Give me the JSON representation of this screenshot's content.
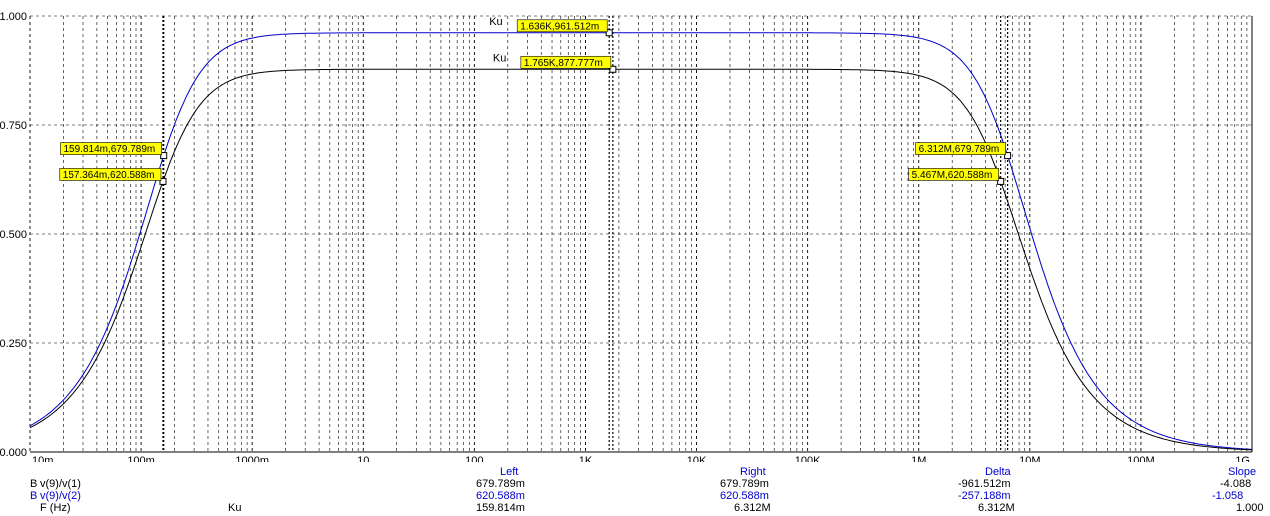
{
  "chart_data": {
    "type": "line",
    "x_scale": "log",
    "xlim": [
      0.01,
      1000000000
    ],
    "ylim": [
      0,
      1
    ],
    "grid": true,
    "y_ticks": [
      "0.000",
      "0.250",
      "0.500",
      "0.750",
      "1.000"
    ],
    "x_ticks": [
      "10m",
      "100m",
      "1000m",
      "10",
      "100",
      "1K",
      "10K",
      "100K",
      "1M",
      "10M",
      "100M",
      "1G"
    ],
    "series": [
      {
        "name": "Ku",
        "color": "#0000cc",
        "gain": 0.9615,
        "fl": 0.1598,
        "fh": 6312000
      },
      {
        "name": "Ku",
        "color": "#000000",
        "gain": 0.8778,
        "fl": 0.1574,
        "fh": 5467000
      }
    ],
    "curve_labels": [
      {
        "text": "Ku",
        "x": 1636,
        "y": 0.9615
      },
      {
        "text": "Ku",
        "x": 1765,
        "y": 0.8778
      }
    ],
    "markers": [
      {
        "label": "1.636K,961.512m",
        "x": 1636,
        "y": 0.9615,
        "side": "left"
      },
      {
        "label": "1.765K,877.777m",
        "x": 1765,
        "y": 0.8778,
        "side": "left"
      },
      {
        "label": "159.814m,679.789m",
        "x": 0.1598,
        "y": 0.6798,
        "side": "left"
      },
      {
        "label": "157.364m,620.588m",
        "x": 0.1574,
        "y": 0.6206,
        "side": "left"
      },
      {
        "label": "6.312M,679.789m",
        "x": 6312000,
        "y": 0.6798,
        "side": "left"
      },
      {
        "label": "5.467M,620.588m",
        "x": 5467000,
        "y": 0.6206,
        "side": "left"
      }
    ],
    "cursor_x": [
      0.1574,
      0.1598,
      1636,
      1765,
      5467000,
      6312000
    ]
  },
  "table": {
    "headers": [
      "Left",
      "Right",
      "Delta",
      "Slope"
    ],
    "rows": [
      {
        "icon": "B",
        "name": "v(9)/v(1)",
        "left": "679.789m",
        "right": "679.789m",
        "delta": "-961.512m",
        "slope": "-4.088"
      },
      {
        "icon": "B",
        "name": "v(9)/v(2)",
        "left": "620.588m",
        "right": "620.588m",
        "delta": "-257.188m",
        "slope": "-1.058"
      }
    ],
    "x_row": {
      "name": "F (Hz)",
      "extra": "Ku",
      "left": "159.814m",
      "right": "6.312M",
      "delta": "6.312M",
      "slope": "1.000"
    }
  }
}
